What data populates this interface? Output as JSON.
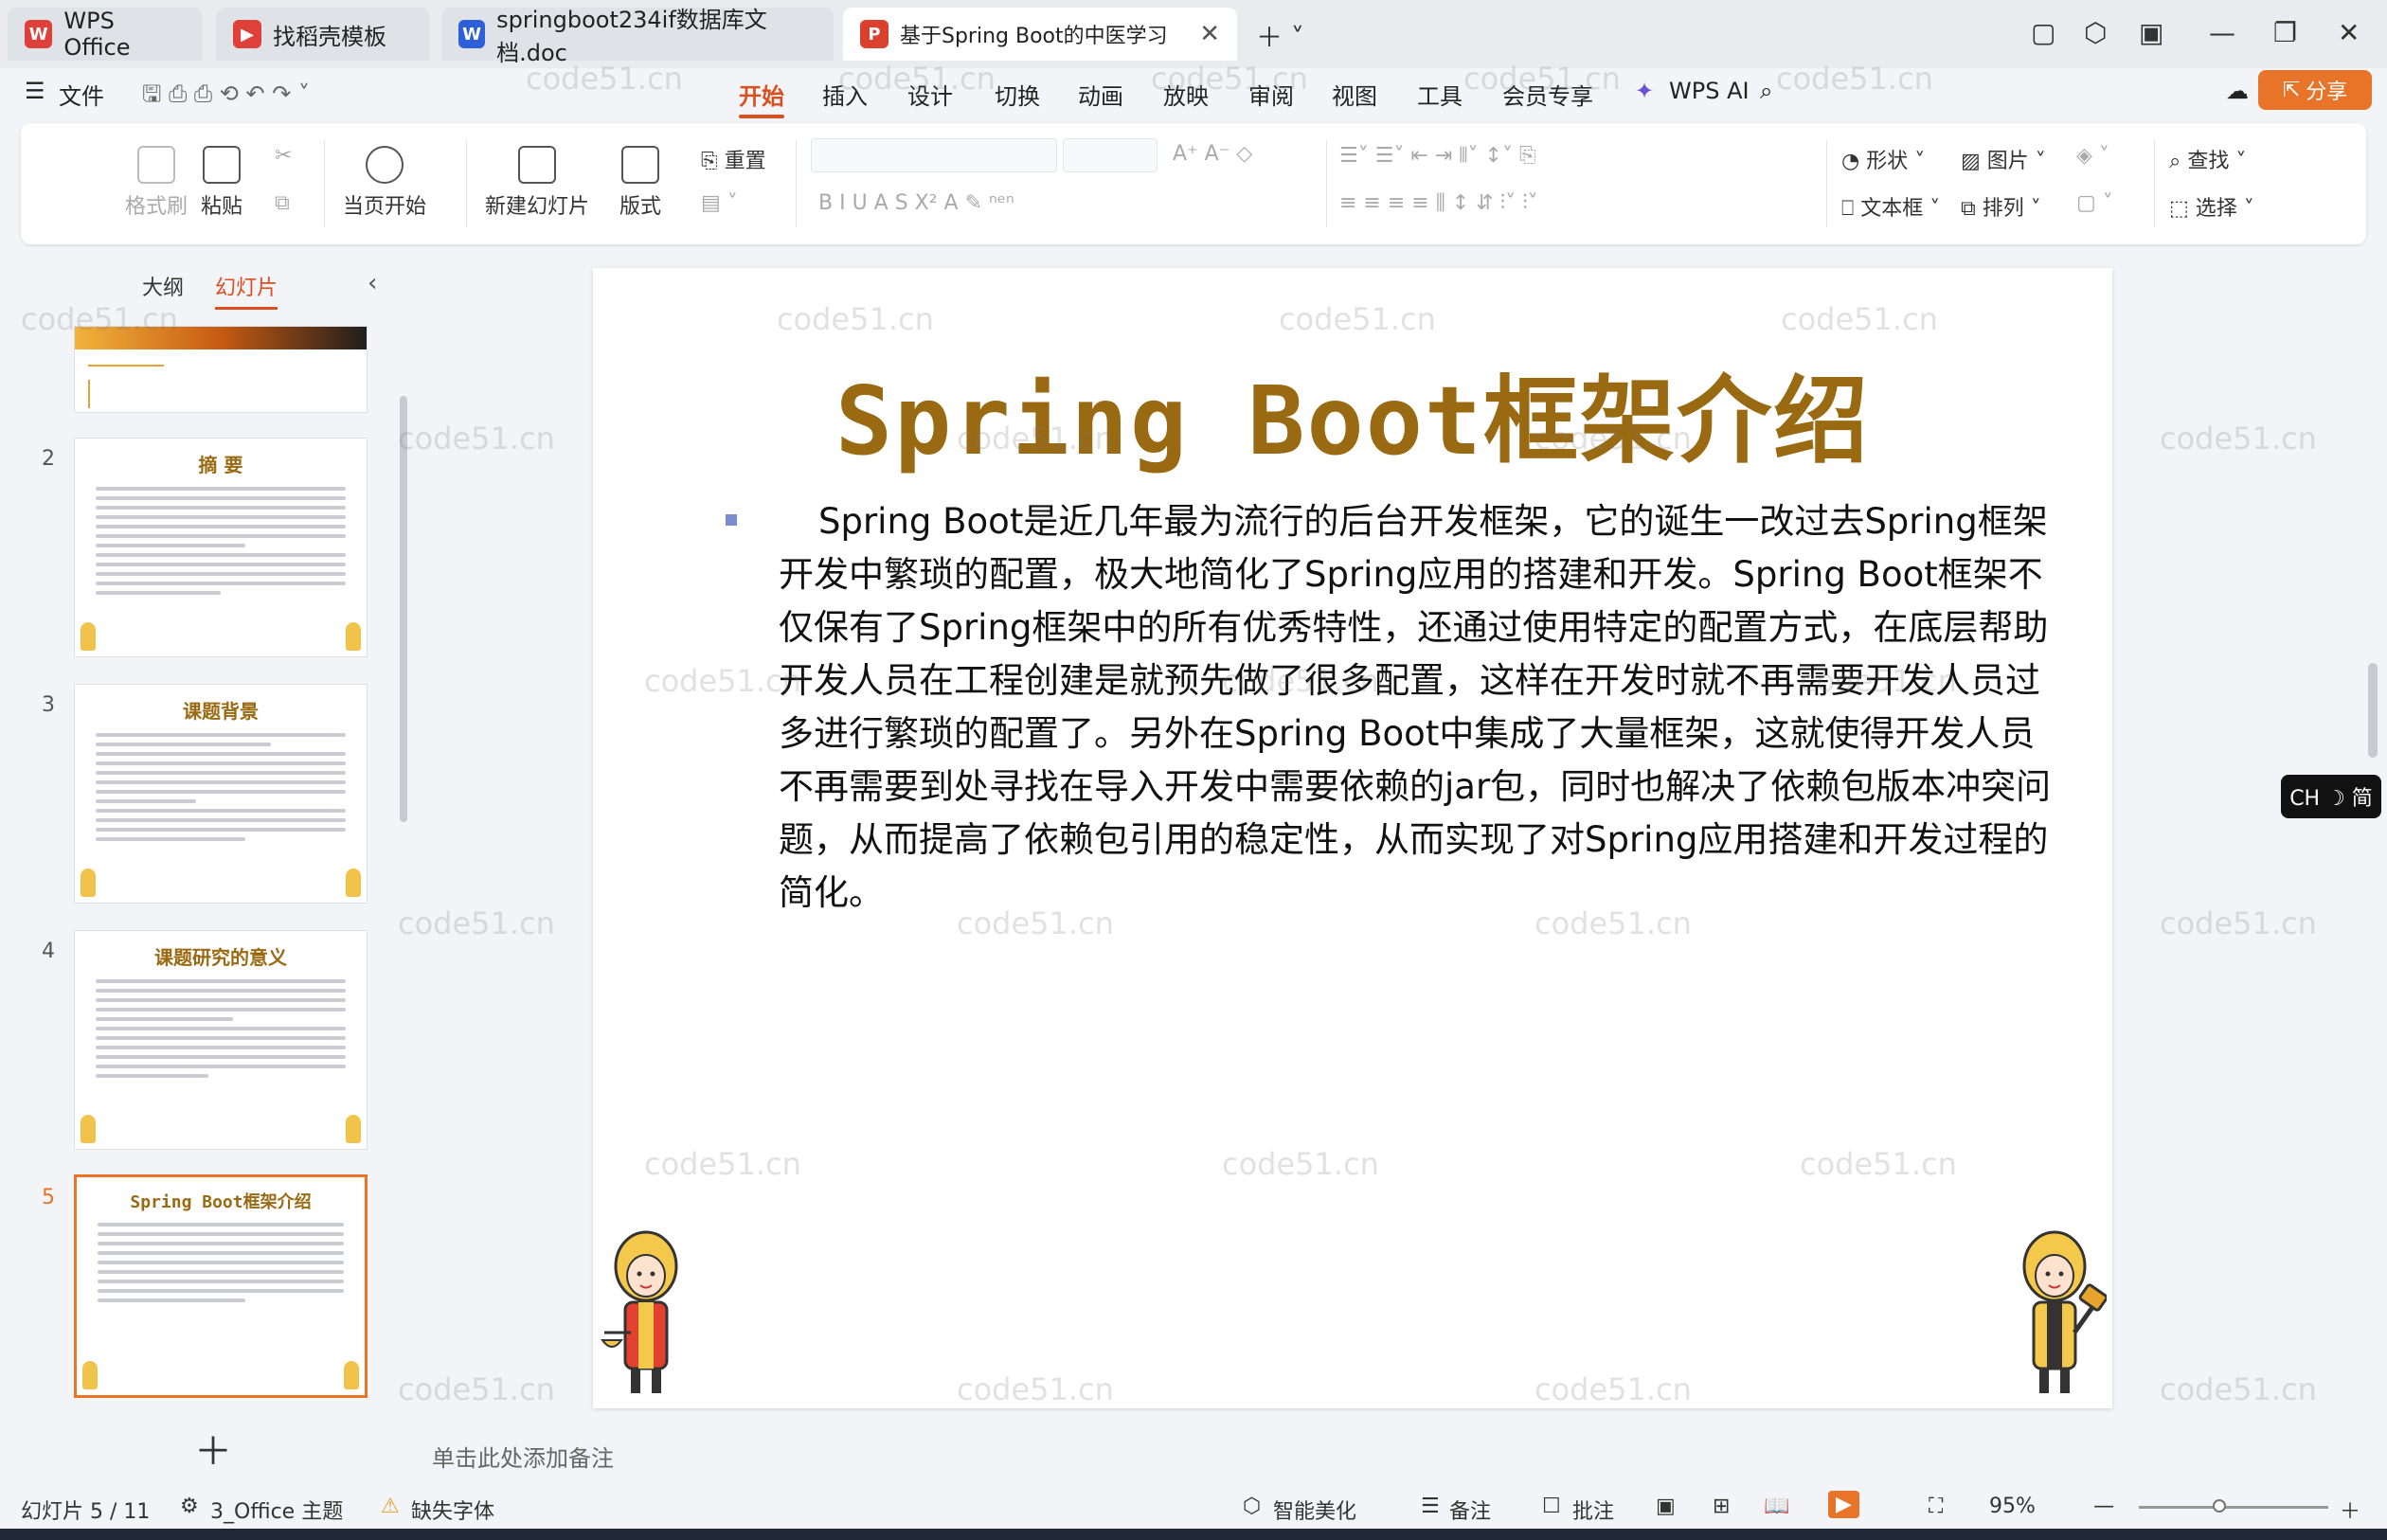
{
  "tabs": [
    {
      "label": "WPS Office",
      "icon": "wps-logo-icon"
    },
    {
      "label": "找稻壳模板",
      "icon": "docer-icon"
    },
    {
      "label": "springboot234if数据库文档.doc",
      "icon": "word-doc-icon"
    },
    {
      "label": "基于Spring Boot的中医学习",
      "icon": "ppt-doc-icon"
    }
  ],
  "menu": {
    "file": "文件",
    "items": [
      "开始",
      "插入",
      "设计",
      "切换",
      "动画",
      "放映",
      "审阅",
      "视图",
      "工具",
      "会员专享",
      "WPS AI"
    ],
    "active": "开始",
    "share": "分享"
  },
  "ribbon": {
    "format_painter": "格式刷",
    "paste": "粘贴",
    "play_from_current": "当页开始",
    "new_slide": "新建幻灯片",
    "layout": "版式",
    "reset": "重置",
    "shape": "形状",
    "picture": "图片",
    "find": "查找",
    "textbox": "文本框",
    "arrange": "排列",
    "select": "选择"
  },
  "left_panel": {
    "tab_outline": "大纲",
    "tab_slides": "幻灯片",
    "active_tab": "幻灯片",
    "thumbnails": [
      {
        "num": "2",
        "title": "摘 要"
      },
      {
        "num": "3",
        "title": "课题背景"
      },
      {
        "num": "4",
        "title": "课题研究的意义"
      },
      {
        "num": "5",
        "title": "Spring Boot框架介绍"
      }
    ],
    "selected": "5"
  },
  "slide": {
    "title": "Spring Boot框架介绍",
    "body": "Spring Boot是近几年最为流行的后台开发框架，它的诞生一改过去Spring框架开发中繁琐的配置，极大地简化了Spring应用的搭建和开发。Spring Boot框架不仅保有了Spring框架中的所有优秀特性，还通过使用特定的配置方式，在底层帮助开发人员在工程创建是就预先做了很多配置，这样在开发时就不再需要开发人员过多进行繁琐的配置了。另外在Spring Boot中集成了大量框架，这就使得开发人员不再需要到处寻找在导入开发中需要依赖的jar包，同时也解决了依赖包版本冲突问题，从而提高了依赖包引用的稳定性，从而实现了对Spring应用搭建和开发过程的简化。"
  },
  "notes_placeholder": "单击此处添加备注",
  "status": {
    "slide_counter": "幻灯片 5 / 11",
    "theme": "3_Office 主题",
    "missing_font": "缺失字体",
    "smart_beautify": "智能美化",
    "notes": "备注",
    "comments": "批注",
    "zoom": "95%"
  },
  "ime": "CH ☽ 简",
  "watermark": "code51.cn",
  "colors": {
    "accent": "#d9501e",
    "title_gold": "#9a6a12",
    "share_orange": "#e8742a"
  }
}
